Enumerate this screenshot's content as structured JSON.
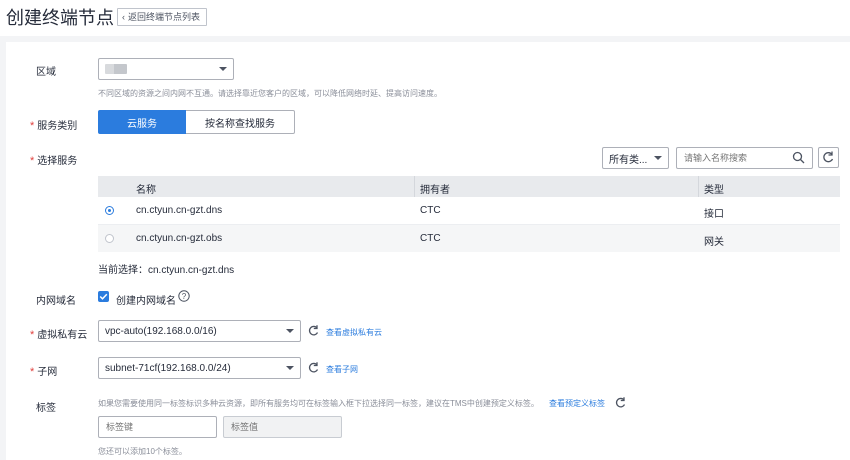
{
  "header": {
    "title": "创建终端节点",
    "back_label": "返回终端节点列表"
  },
  "region": {
    "label": "区域",
    "value_placeholder": "",
    "hint": "不同区域的资源之间内网不互通。请选择靠近您客户的区域，可以降低网络时延、提高访问速度。"
  },
  "service_category": {
    "label": "服务类别",
    "options": [
      "云服务",
      "按名称查找服务"
    ],
    "selected": "云服务"
  },
  "select_service": {
    "label": "选择服务",
    "type_filter": "所有类...",
    "search_placeholder": "请输入名称搜索",
    "columns": [
      "名称",
      "拥有者",
      "类型"
    ],
    "rows": [
      {
        "name": "cn.ctyun.cn-gzt.dns",
        "owner": "CTC",
        "type": "接口",
        "selected": true
      },
      {
        "name": "cn.ctyun.cn-gzt.obs",
        "owner": "CTC",
        "type": "网关",
        "selected": false
      }
    ],
    "current_selection": "当前选择：cn.ctyun.cn-gzt.dns"
  },
  "private_dns": {
    "label": "内网域名",
    "checkbox_label": "创建内网域名",
    "checked": true
  },
  "vpc": {
    "label": "虚拟私有云",
    "value": "vpc-auto(192.168.0.0/16)",
    "link": "查看虚拟私有云"
  },
  "subnet": {
    "label": "子网",
    "value": "subnet-71cf(192.168.0.0/24)",
    "link": "查看子网"
  },
  "tags": {
    "label": "标签",
    "hint": "如果您需要使用同一标签标识多种云资源，即所有服务均可在标签输入框下拉选择同一标签，建议在TMS中创建预定义标签。",
    "hint_link": "查看预定义标签",
    "key_placeholder": "标签键",
    "value_placeholder": "标签值",
    "remaining": "您还可以添加10个标签。"
  },
  "colors": {
    "accent": "#2b7cde",
    "required": "#e0403e"
  }
}
